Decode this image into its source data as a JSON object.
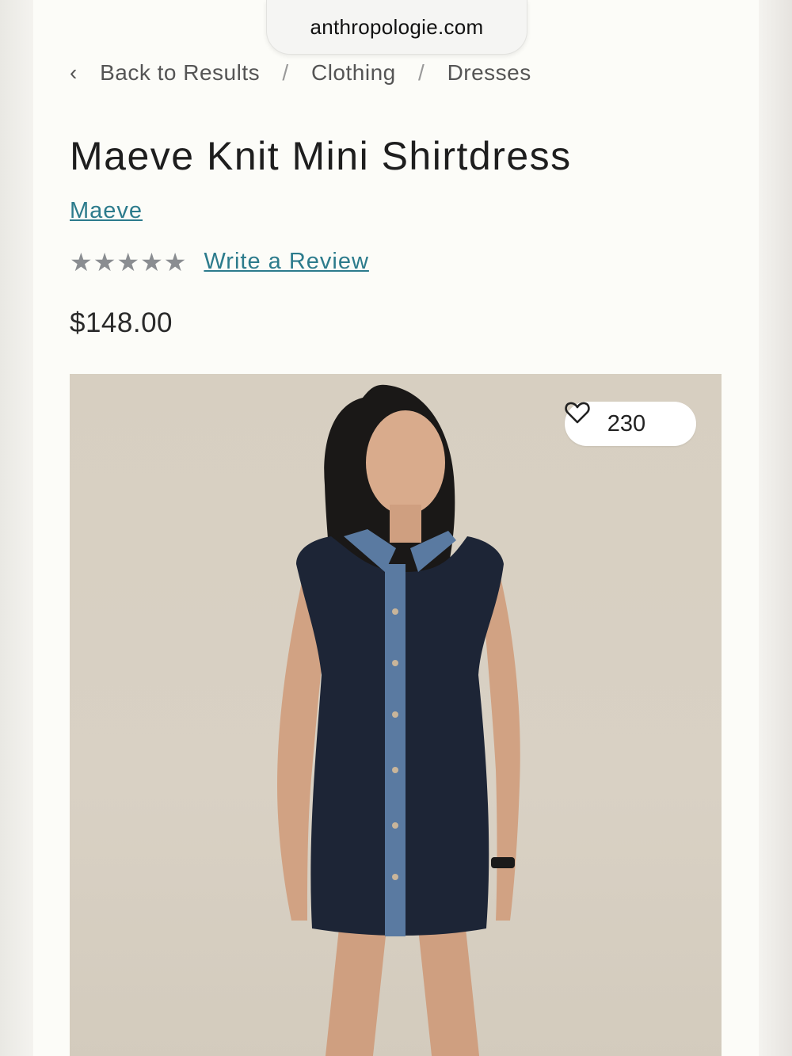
{
  "browser": {
    "url": "anthropologie.com"
  },
  "breadcrumb": {
    "items": [
      "Back to Results",
      "Clothing",
      "Dresses"
    ],
    "separator": "/"
  },
  "product": {
    "title": "Maeve Knit Mini Shirtdress",
    "brand": "Maeve",
    "rating_stars": 5,
    "rating_filled": 0,
    "review_link": "Write a Review",
    "price": "$148.00",
    "favorites_count": "230"
  },
  "icons": {
    "back": "chevron-left-icon",
    "favorite": "heart-icon",
    "star": "star-icon"
  },
  "colors": {
    "link": "#2c7b8c",
    "star": "#8a8d91",
    "page_bg": "#fcfcf8"
  }
}
